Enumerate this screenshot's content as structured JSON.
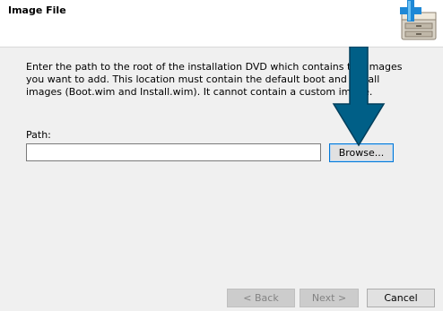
{
  "header": {
    "title": "Image File",
    "icon": "add-image-icon"
  },
  "main": {
    "description": "Enter the path to the root of the installation DVD which contains the images you want to add. This location must contain the default boot and install images (Boot.wim and Install.wim). It cannot contain a custom image.",
    "path_label": "Path:",
    "path_value": "",
    "browse_label": "Browse..."
  },
  "footer": {
    "back_label": "< Back",
    "next_label": "Next >",
    "cancel_label": "Cancel"
  },
  "annotation": {
    "icon": "down-arrow-icon",
    "color": "#005f87"
  }
}
